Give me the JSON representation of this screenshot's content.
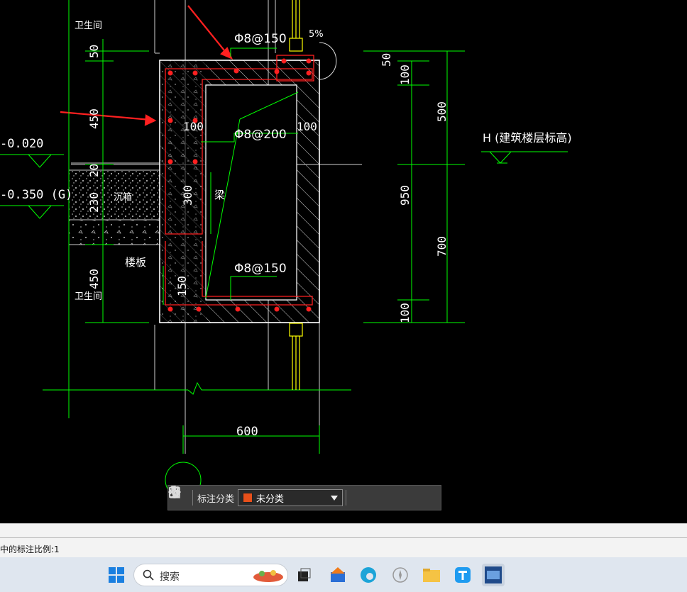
{
  "drawing": {
    "room_top": "卫生间",
    "room_bottom": "卫生间",
    "elev_1": "-0.020",
    "elev_2": "-0.350 (G)",
    "sunken_box": "沉箱",
    "floor_slab": "楼板",
    "beam": "梁",
    "rebar_top": "Φ8@150",
    "rebar_mid": "Φ8@200",
    "rebar_bottom": "Φ8@150",
    "slope": "5%",
    "dim_100_left": "100",
    "dim_100_right": "100",
    "dim_300": "300",
    "dim_150": "150",
    "dim_600": "600",
    "left_dim_50": "50",
    "left_dim_450_top": "450",
    "left_dim_230": "230",
    "left_dim_20": "20",
    "left_dim_450_bottom": "450",
    "right_dim_50": "50",
    "right_dim_100_top": "100",
    "right_dim_500": "500",
    "right_dim_950": "950",
    "right_dim_700": "700",
    "right_dim_100_bottom": "100",
    "floor_level_label": "H (建筑楼层标高)"
  },
  "toolbar": {
    "label": "标注分类",
    "selected": "未分类",
    "swatch_color": "#e8501a"
  },
  "status": {
    "command_text": "中的标注比例:1"
  },
  "taskbar": {
    "search_placeholder": "搜索"
  },
  "colors": {
    "cad_bg": "#000000",
    "green": "#00ff00",
    "red": "#ff2020",
    "white": "#ffffff"
  }
}
